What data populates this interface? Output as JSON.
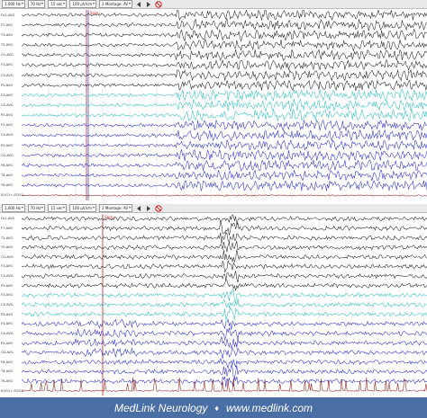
{
  "toolbar_top": {
    "controls": [
      "1,000 Hz",
      "70 Hz",
      "15 sec",
      "100 µV/cm",
      "2 Montage: AV"
    ],
    "icons": [
      "prev-icon",
      "next-icon",
      "no-entry-icon"
    ]
  },
  "toolbar_bottom": {
    "controls": [
      "1,000 Hz",
      "70 Hz",
      "15 sec",
      "100 µV/cm",
      "2 Montage: AV"
    ],
    "icons": [
      "prev-icon",
      "next-icon",
      "no-entry-icon"
    ]
  },
  "marker_label": "Seizu",
  "channels_top": [
    {
      "label": "Fp1-AVG",
      "color": "#222222"
    },
    {
      "label": "F7-AVG",
      "color": "#222222"
    },
    {
      "label": "T3-AVG",
      "color": "#222222"
    },
    {
      "label": "T5-AVG",
      "color": "#222222"
    },
    {
      "label": "O1-AVG",
      "color": "#222222"
    },
    {
      "label": "F3-AVG",
      "color": "#222222"
    },
    {
      "label": "C3-AVG",
      "color": "#222222"
    },
    {
      "label": "P3-AVG",
      "color": "#222222"
    },
    {
      "label": "FZ-AVG",
      "color": "#2fbfbf"
    },
    {
      "label": "CZ-AVG",
      "color": "#2fbfbf"
    },
    {
      "label": "PZ-AVG",
      "color": "#2fbfbf"
    },
    {
      "label": "F4-AVG",
      "color": "#2a2fc9"
    },
    {
      "label": "C4-AVG",
      "color": "#2a2fc9"
    },
    {
      "label": "P4-AVG",
      "color": "#2a2fc9"
    },
    {
      "label": "O2-AVG",
      "color": "#2a2fc9"
    },
    {
      "label": "F8-AVG",
      "color": "#2a2fc9"
    },
    {
      "label": "T4-AVG",
      "color": "#2a2fc9"
    },
    {
      "label": "T6-AVG",
      "color": "#2a2fc9"
    },
    {
      "label": "EOG1+-EOG1-",
      "color": "#8b1a1a"
    }
  ],
  "channels_bottom": [
    {
      "label": "Fp1-AVG",
      "color": "#222222"
    },
    {
      "label": "F7-AVG",
      "color": "#222222"
    },
    {
      "label": "T3-AVG",
      "color": "#222222"
    },
    {
      "label": "T5-AVG",
      "color": "#222222"
    },
    {
      "label": "O1-AVG",
      "color": "#222222"
    },
    {
      "label": "F3-AVG",
      "color": "#222222"
    },
    {
      "label": "C3-AVG",
      "color": "#222222"
    },
    {
      "label": "P3-AVG",
      "color": "#222222"
    },
    {
      "label": "FZ-AVG",
      "color": "#2fbfbf"
    },
    {
      "label": "CZ-AVG",
      "color": "#2fbfbf"
    },
    {
      "label": "PZ-AVG",
      "color": "#2fbfbf"
    },
    {
      "label": "F4-AVG",
      "color": "#2a2fc9"
    },
    {
      "label": "C4-AVG",
      "color": "#2a2fc9"
    },
    {
      "label": "P4-AVG",
      "color": "#2a2fc9"
    },
    {
      "label": "O2-AVG",
      "color": "#2a2fc9"
    },
    {
      "label": "F8-AVG",
      "color": "#2a2fc9"
    },
    {
      "label": "T4-AVG",
      "color": "#2a2fc9"
    },
    {
      "label": "T6-AVG",
      "color": "#2a2fc9"
    },
    {
      "label": "EOG1+-EOG1-",
      "color": "#8b1a1a"
    }
  ],
  "footer": {
    "brand": "MedLink Neurology",
    "separator": "♦",
    "url": "www.medlink.com"
  },
  "colors": {
    "marker": "#d11f1f",
    "cursor": "#3a5fd0",
    "footer_bg": "#4a6fa5"
  }
}
